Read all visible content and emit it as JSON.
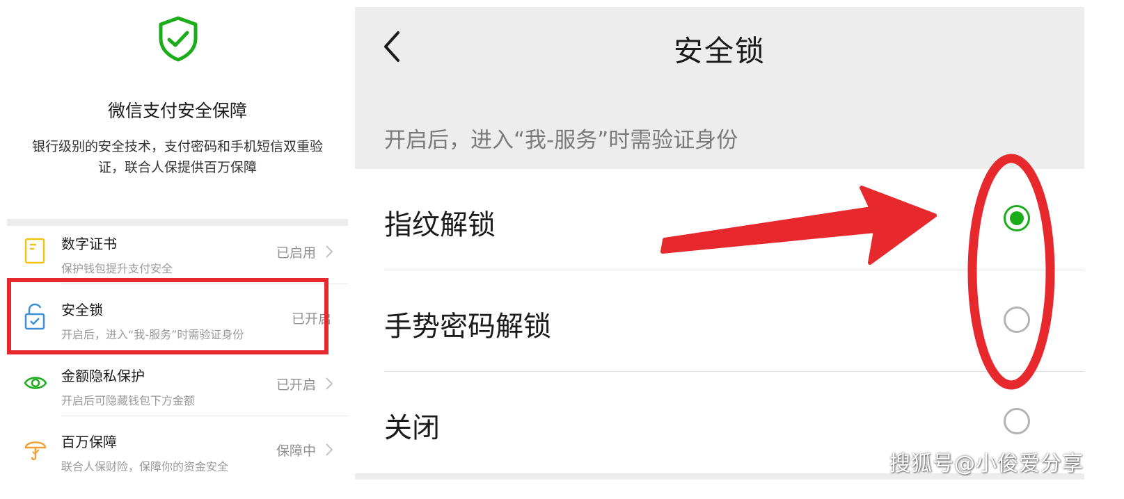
{
  "left": {
    "title": "微信支付安全保障",
    "description": "银行级别的安全技术，支付密码和手机短信双重验证，联合人保提供百万保障",
    "items": [
      {
        "label": "数字证书",
        "sub": "保护钱包提升支付安全",
        "status": "已启用",
        "icon": "certificate-icon",
        "color": "#f2c316"
      },
      {
        "label": "安全锁",
        "sub": "开启后，进入“我-服务”时需验证身份",
        "status": "已开启",
        "icon": "lock-icon",
        "color": "#3f8ed6"
      },
      {
        "label": "金额隐私保护",
        "sub": "开启后可隐藏钱包下方金额",
        "status": "已开启",
        "icon": "eye-icon",
        "color": "#1aad19"
      },
      {
        "label": "百万保障",
        "sub": "联合人保财险，保障你的资金安全",
        "status": "保障中",
        "icon": "umbrella-icon",
        "color": "#f0a033"
      }
    ],
    "accent": "#1aad19"
  },
  "right": {
    "title": "安全锁",
    "tip": "开启后，进入“我-服务”时需验证身份",
    "options": [
      {
        "label": "指纹解锁",
        "selected": true
      },
      {
        "label": "手势密码解锁",
        "selected": false
      },
      {
        "label": "关闭",
        "selected": false
      }
    ]
  },
  "annotation_color": "#e7282d",
  "watermark": "搜狐号@小俊爱分享"
}
